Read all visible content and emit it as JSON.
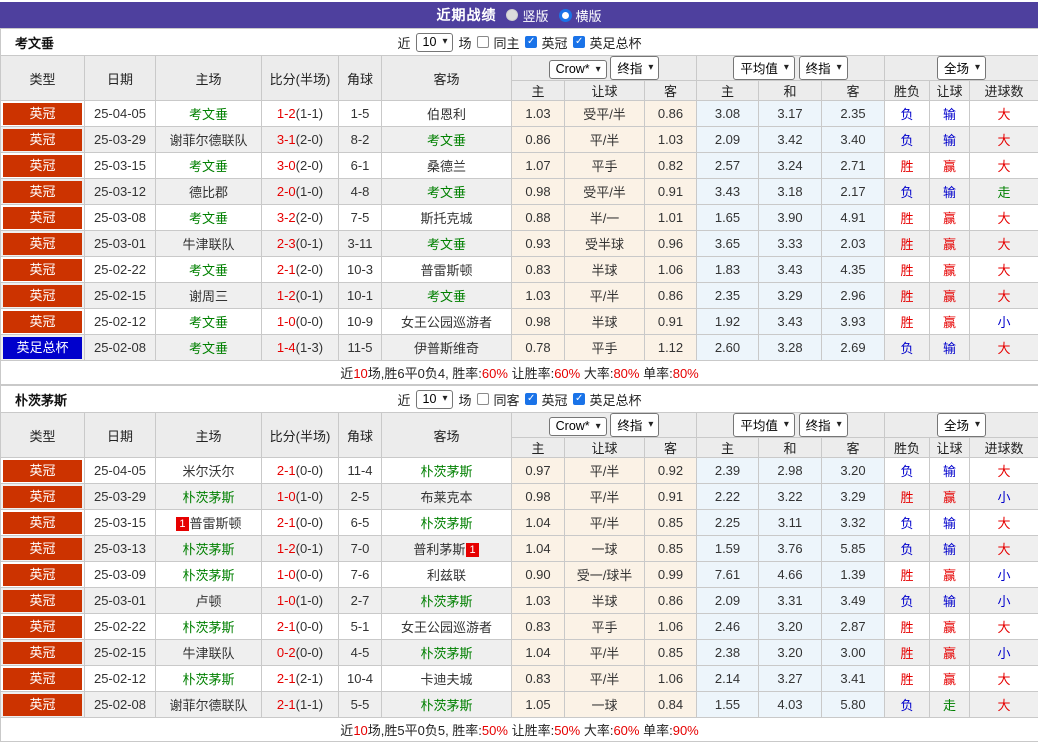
{
  "titlebar": {
    "title": "近期战绩",
    "radio_vertical": "竖版",
    "radio_horizontal": "横版"
  },
  "columns": {
    "type": "类型",
    "date": "日期",
    "home": "主场",
    "score": "比分(半场)",
    "corner": "角球",
    "away": "客场",
    "odds_home": "主",
    "odds_handicap": "让球",
    "odds_away": "客",
    "avg_home": "主",
    "avg_draw": "和",
    "avg_away": "客",
    "res_winlose": "胜负",
    "res_handicap": "让球",
    "res_goals": "进球数"
  },
  "dropdowns": {
    "source": "Crow*",
    "source_time": "终指",
    "avg": "平均值",
    "avg_time": "终指",
    "scope": "全场"
  },
  "result_colors": {
    "胜": "red",
    "负": "blue",
    "平": "green",
    "赢": "red",
    "输": "blue",
    "走": "green",
    "大": "red",
    "小": "blue"
  },
  "colors": {
    "header_bar": "#4e409e",
    "league_badge": "#cc3300",
    "cup_badge": "#0000cc",
    "team_highlight": "#008000",
    "score_red": "#e60000",
    "result_blue": "#0000cc",
    "odds_group_bg": "#fbf2e6",
    "avg_group_bg": "#edf5fb",
    "checkbox_blue": "#1a73e8"
  },
  "sections": [
    {
      "team": "考文垂",
      "filter": {
        "near": "近",
        "count": "10",
        "games": "场",
        "same": "同主",
        "league": "英冠",
        "cup": "英足总杯"
      },
      "rows": [
        {
          "type": "英冠",
          "cup": false,
          "date": "25-04-05",
          "home": "考文垂",
          "hg": true,
          "hcard": "",
          "ft": "1-2",
          "ht": "(1-1)",
          "cor": "1-5",
          "away": "伯恩利",
          "ag": false,
          "acard": "",
          "o1": "1.03",
          "hd": "受平/半",
          "o2": "0.86",
          "m1": "3.08",
          "m2": "3.17",
          "m3": "2.35",
          "r1": "负",
          "r2": "输",
          "r3": "大"
        },
        {
          "type": "英冠",
          "cup": false,
          "date": "25-03-29",
          "home": "谢菲尔德联队",
          "hg": false,
          "hcard": "",
          "ft": "3-1",
          "ht": "(2-0)",
          "cor": "8-2",
          "away": "考文垂",
          "ag": true,
          "acard": "",
          "o1": "0.86",
          "hd": "平/半",
          "o2": "1.03",
          "m1": "2.09",
          "m2": "3.42",
          "m3": "3.40",
          "r1": "负",
          "r2": "输",
          "r3": "大"
        },
        {
          "type": "英冠",
          "cup": false,
          "date": "25-03-15",
          "home": "考文垂",
          "hg": true,
          "hcard": "",
          "ft": "3-0",
          "ht": "(2-0)",
          "cor": "6-1",
          "away": "桑德兰",
          "ag": false,
          "acard": "",
          "o1": "1.07",
          "hd": "平手",
          "o2": "0.82",
          "m1": "2.57",
          "m2": "3.24",
          "m3": "2.71",
          "r1": "胜",
          "r2": "赢",
          "r3": "大"
        },
        {
          "type": "英冠",
          "cup": false,
          "date": "25-03-12",
          "home": "德比郡",
          "hg": false,
          "hcard": "",
          "ft": "2-0",
          "ht": "(1-0)",
          "cor": "4-8",
          "away": "考文垂",
          "ag": true,
          "acard": "",
          "o1": "0.98",
          "hd": "受平/半",
          "o2": "0.91",
          "m1": "3.43",
          "m2": "3.18",
          "m3": "2.17",
          "r1": "负",
          "r2": "输",
          "r3": "走"
        },
        {
          "type": "英冠",
          "cup": false,
          "date": "25-03-08",
          "home": "考文垂",
          "hg": true,
          "hcard": "",
          "ft": "3-2",
          "ht": "(2-0)",
          "cor": "7-5",
          "away": "斯托克城",
          "ag": false,
          "acard": "",
          "o1": "0.88",
          "hd": "半/一",
          "o2": "1.01",
          "m1": "1.65",
          "m2": "3.90",
          "m3": "4.91",
          "r1": "胜",
          "r2": "赢",
          "r3": "大"
        },
        {
          "type": "英冠",
          "cup": false,
          "date": "25-03-01",
          "home": "牛津联队",
          "hg": false,
          "hcard": "",
          "ft": "2-3",
          "ht": "(0-1)",
          "cor": "3-11",
          "away": "考文垂",
          "ag": true,
          "acard": "",
          "o1": "0.93",
          "hd": "受半球",
          "o2": "0.96",
          "m1": "3.65",
          "m2": "3.33",
          "m3": "2.03",
          "r1": "胜",
          "r2": "赢",
          "r3": "大"
        },
        {
          "type": "英冠",
          "cup": false,
          "date": "25-02-22",
          "home": "考文垂",
          "hg": true,
          "hcard": "",
          "ft": "2-1",
          "ht": "(2-0)",
          "cor": "10-3",
          "away": "普雷斯顿",
          "ag": false,
          "acard": "",
          "o1": "0.83",
          "hd": "半球",
          "o2": "1.06",
          "m1": "1.83",
          "m2": "3.43",
          "m3": "4.35",
          "r1": "胜",
          "r2": "赢",
          "r3": "大"
        },
        {
          "type": "英冠",
          "cup": false,
          "date": "25-02-15",
          "home": "谢周三",
          "hg": false,
          "hcard": "",
          "ft": "1-2",
          "ht": "(0-1)",
          "cor": "10-1",
          "away": "考文垂",
          "ag": true,
          "acard": "",
          "o1": "1.03",
          "hd": "平/半",
          "o2": "0.86",
          "m1": "2.35",
          "m2": "3.29",
          "m3": "2.96",
          "r1": "胜",
          "r2": "赢",
          "r3": "大"
        },
        {
          "type": "英冠",
          "cup": false,
          "date": "25-02-12",
          "home": "考文垂",
          "hg": true,
          "hcard": "",
          "ft": "1-0",
          "ht": "(0-0)",
          "cor": "10-9",
          "away": "女王公园巡游者",
          "ag": false,
          "acard": "",
          "o1": "0.98",
          "hd": "半球",
          "o2": "0.91",
          "m1": "1.92",
          "m2": "3.43",
          "m3": "3.93",
          "r1": "胜",
          "r2": "赢",
          "r3": "小"
        },
        {
          "type": "英足总杯",
          "cup": true,
          "date": "25-02-08",
          "home": "考文垂",
          "hg": true,
          "hcard": "",
          "ft": "1-4",
          "ht": "(1-3)",
          "cor": "11-5",
          "away": "伊普斯维奇",
          "ag": false,
          "acard": "",
          "o1": "0.78",
          "hd": "平手",
          "o2": "1.12",
          "m1": "2.60",
          "m2": "3.28",
          "m3": "2.69",
          "r1": "负",
          "r2": "输",
          "r3": "大"
        }
      ],
      "summary": [
        {
          "t": "近",
          "red": false
        },
        {
          "t": "10",
          "red": true
        },
        {
          "t": "场,胜6平0负4, 胜率:",
          "red": false
        },
        {
          "t": "60%",
          "red": true
        },
        {
          "t": " 让胜率:",
          "red": false
        },
        {
          "t": "60%",
          "red": true
        },
        {
          "t": " 大率:",
          "red": false
        },
        {
          "t": "80%",
          "red": true
        },
        {
          "t": " 单率:",
          "red": false
        },
        {
          "t": "80%",
          "red": true
        }
      ]
    },
    {
      "team": "朴茨茅斯",
      "filter": {
        "near": "近",
        "count": "10",
        "games": "场",
        "same": "同客",
        "league": "英冠",
        "cup": "英足总杯"
      },
      "rows": [
        {
          "type": "英冠",
          "cup": false,
          "date": "25-04-05",
          "home": "米尔沃尔",
          "hg": false,
          "hcard": "",
          "ft": "2-1",
          "ht": "(0-0)",
          "cor": "11-4",
          "away": "朴茨茅斯",
          "ag": true,
          "acard": "",
          "o1": "0.97",
          "hd": "平/半",
          "o2": "0.92",
          "m1": "2.39",
          "m2": "2.98",
          "m3": "3.20",
          "r1": "负",
          "r2": "输",
          "r3": "大"
        },
        {
          "type": "英冠",
          "cup": false,
          "date": "25-03-29",
          "home": "朴茨茅斯",
          "hg": true,
          "hcard": "",
          "ft": "1-0",
          "ht": "(1-0)",
          "cor": "2-5",
          "away": "布莱克本",
          "ag": false,
          "acard": "",
          "o1": "0.98",
          "hd": "平/半",
          "o2": "0.91",
          "m1": "2.22",
          "m2": "3.22",
          "m3": "3.29",
          "r1": "胜",
          "r2": "赢",
          "r3": "小"
        },
        {
          "type": "英冠",
          "cup": false,
          "date": "25-03-15",
          "home": "普雷斯顿",
          "hg": false,
          "hcard": "1",
          "ft": "2-1",
          "ht": "(0-0)",
          "cor": "6-5",
          "away": "朴茨茅斯",
          "ag": true,
          "acard": "",
          "o1": "1.04",
          "hd": "平/半",
          "o2": "0.85",
          "m1": "2.25",
          "m2": "3.11",
          "m3": "3.32",
          "r1": "负",
          "r2": "输",
          "r3": "大"
        },
        {
          "type": "英冠",
          "cup": false,
          "date": "25-03-13",
          "home": "朴茨茅斯",
          "hg": true,
          "hcard": "",
          "ft": "1-2",
          "ht": "(0-1)",
          "cor": "7-0",
          "away": "普利茅斯",
          "ag": false,
          "acard": "1",
          "o1": "1.04",
          "hd": "一球",
          "o2": "0.85",
          "m1": "1.59",
          "m2": "3.76",
          "m3": "5.85",
          "r1": "负",
          "r2": "输",
          "r3": "大"
        },
        {
          "type": "英冠",
          "cup": false,
          "date": "25-03-09",
          "home": "朴茨茅斯",
          "hg": true,
          "hcard": "",
          "ft": "1-0",
          "ht": "(0-0)",
          "cor": "7-6",
          "away": "利兹联",
          "ag": false,
          "acard": "",
          "o1": "0.90",
          "hd": "受一/球半",
          "o2": "0.99",
          "m1": "7.61",
          "m2": "4.66",
          "m3": "1.39",
          "r1": "胜",
          "r2": "赢",
          "r3": "小"
        },
        {
          "type": "英冠",
          "cup": false,
          "date": "25-03-01",
          "home": "卢顿",
          "hg": false,
          "hcard": "",
          "ft": "1-0",
          "ht": "(1-0)",
          "cor": "2-7",
          "away": "朴茨茅斯",
          "ag": true,
          "acard": "",
          "o1": "1.03",
          "hd": "半球",
          "o2": "0.86",
          "m1": "2.09",
          "m2": "3.31",
          "m3": "3.49",
          "r1": "负",
          "r2": "输",
          "r3": "小"
        },
        {
          "type": "英冠",
          "cup": false,
          "date": "25-02-22",
          "home": "朴茨茅斯",
          "hg": true,
          "hcard": "",
          "ft": "2-1",
          "ht": "(0-0)",
          "cor": "5-1",
          "away": "女王公园巡游者",
          "ag": false,
          "acard": "",
          "o1": "0.83",
          "hd": "平手",
          "o2": "1.06",
          "m1": "2.46",
          "m2": "3.20",
          "m3": "2.87",
          "r1": "胜",
          "r2": "赢",
          "r3": "大"
        },
        {
          "type": "英冠",
          "cup": false,
          "date": "25-02-15",
          "home": "牛津联队",
          "hg": false,
          "hcard": "",
          "ft": "0-2",
          "ht": "(0-0)",
          "cor": "4-5",
          "away": "朴茨茅斯",
          "ag": true,
          "acard": "",
          "o1": "1.04",
          "hd": "平/半",
          "o2": "0.85",
          "m1": "2.38",
          "m2": "3.20",
          "m3": "3.00",
          "r1": "胜",
          "r2": "赢",
          "r3": "小"
        },
        {
          "type": "英冠",
          "cup": false,
          "date": "25-02-12",
          "home": "朴茨茅斯",
          "hg": true,
          "hcard": "",
          "ft": "2-1",
          "ht": "(2-1)",
          "cor": "10-4",
          "away": "卡迪夫城",
          "ag": false,
          "acard": "",
          "o1": "0.83",
          "hd": "平/半",
          "o2": "1.06",
          "m1": "2.14",
          "m2": "3.27",
          "m3": "3.41",
          "r1": "胜",
          "r2": "赢",
          "r3": "大"
        },
        {
          "type": "英冠",
          "cup": false,
          "date": "25-02-08",
          "home": "谢菲尔德联队",
          "hg": false,
          "hcard": "",
          "ft": "2-1",
          "ht": "(1-1)",
          "cor": "5-5",
          "away": "朴茨茅斯",
          "ag": true,
          "acard": "",
          "o1": "1.05",
          "hd": "一球",
          "o2": "0.84",
          "m1": "1.55",
          "m2": "4.03",
          "m3": "5.80",
          "r1": "负",
          "r2": "走",
          "r3": "大"
        }
      ],
      "summary": [
        {
          "t": "近",
          "red": false
        },
        {
          "t": "10",
          "red": true
        },
        {
          "t": "场,胜5平0负5, 胜率:",
          "red": false
        },
        {
          "t": "50%",
          "red": true
        },
        {
          "t": " 让胜率:",
          "red": false
        },
        {
          "t": "50%",
          "red": true
        },
        {
          "t": " 大率:",
          "red": false
        },
        {
          "t": "60%",
          "red": true
        },
        {
          "t": " 单率:",
          "red": false
        },
        {
          "t": "90%",
          "red": true
        }
      ]
    }
  ]
}
